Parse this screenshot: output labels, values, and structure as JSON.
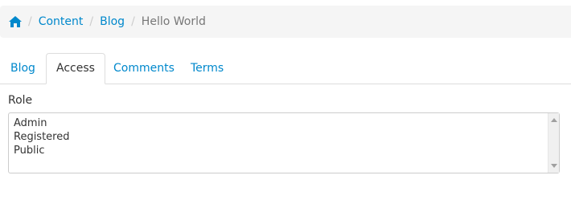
{
  "breadcrumb": {
    "home_icon": "home-icon",
    "items": [
      {
        "label": "Content"
      },
      {
        "label": "Blog"
      }
    ],
    "current": "Hello World",
    "separator": "/"
  },
  "tabs": [
    {
      "label": "Blog",
      "active": false
    },
    {
      "label": "Access",
      "active": true
    },
    {
      "label": "Comments",
      "active": false
    },
    {
      "label": "Terms",
      "active": false
    }
  ],
  "form": {
    "role_label": "Role",
    "role_options": [
      "Admin",
      "Registered",
      "Public"
    ]
  },
  "colors": {
    "link": "#0088cc",
    "text": "#333333",
    "muted": "#777777",
    "breadcrumb_bg": "#f5f5f5",
    "border": "#dddddd"
  }
}
